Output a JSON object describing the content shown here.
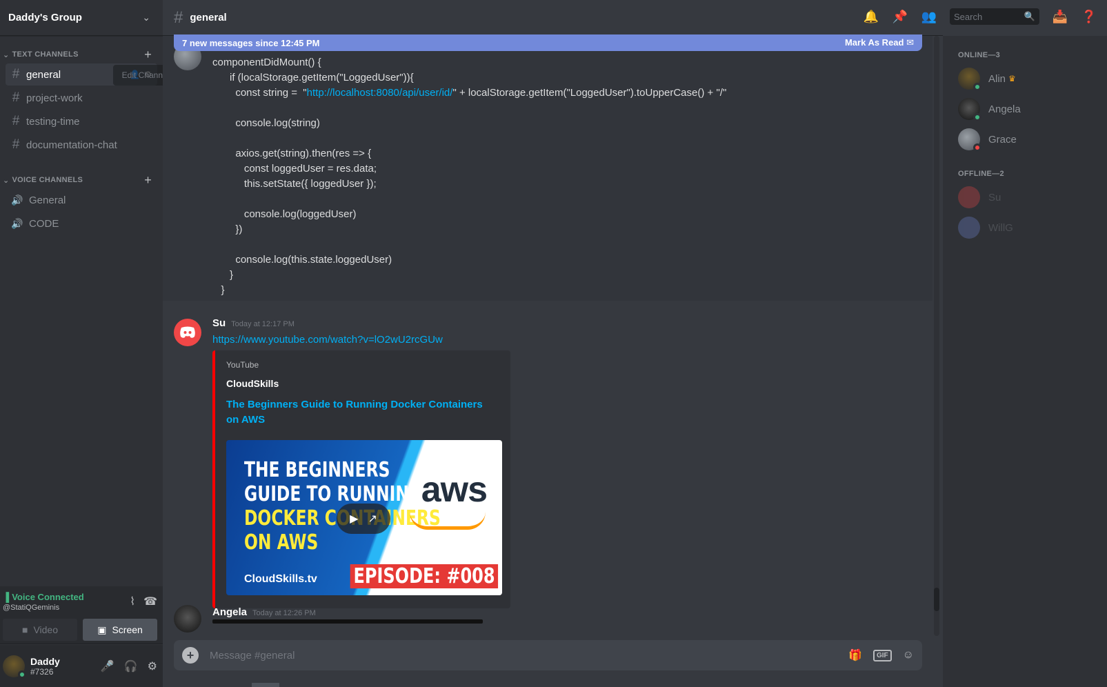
{
  "guild": {
    "name": "Daddy's Group"
  },
  "text_channels": {
    "label": "TEXT CHANNELS",
    "items": [
      "general",
      "project-work",
      "testing-time",
      "documentation-chat"
    ],
    "tooltip": "Edit Channel"
  },
  "voice_channels": {
    "label": "VOICE CHANNELS",
    "items": [
      "General",
      "CODE"
    ]
  },
  "voice_panel": {
    "status": "Voice Connected",
    "sub": "@StatiQGeminis",
    "video_label": "Video",
    "screen_label": "Screen"
  },
  "user": {
    "name": "Daddy",
    "tag": "#7326"
  },
  "header": {
    "channel": "general",
    "search_placeholder": "Search"
  },
  "new_messages": {
    "text": "7 new messages since 12:45 PM",
    "action": "Mark As Read"
  },
  "code_message": {
    "lines": [
      "componentDidMount() {",
      "      if (localStorage.getItem(\"LoggedUser\")){",
      "        const string =  \"",
      "",
      "        console.log(string)",
      "",
      "        axios.get(string).then(res => {",
      "           const loggedUser = res.data;",
      "           this.setState({ loggedUser });",
      "",
      "           console.log(loggedUser)",
      "        })",
      "",
      "        console.log(this.state.loggedUser)",
      "      }",
      "   }"
    ],
    "url": "http://localhost:8080/api/user/id/",
    "url_suffix": "\" + localStorage.getItem(\"LoggedUser\").toUpperCase() + \"/\""
  },
  "su_message": {
    "author": "Su",
    "timestamp": "Today at 12:17 PM",
    "link": "https://www.youtube.com/watch?v=lO2wU2rcGUw",
    "embed": {
      "provider": "YouTube",
      "author": "CloudSkills",
      "title": "The Beginners Guide to Running Docker Containers on AWS",
      "thumb_line1": "THE BEGINNERS",
      "thumb_line2": "GUIDE TO RUNNING",
      "thumb_line3": "DOCKER CONTAINERS",
      "thumb_line4": "ON AWS",
      "thumb_brand": "aws",
      "thumb_site": "CloudSkills.tv",
      "thumb_episode": "EPISODE: #008"
    }
  },
  "angela_message": {
    "author": "Angela",
    "timestamp": "Today at 12:26 PM"
  },
  "composer": {
    "placeholder": "Message #general",
    "gif_label": "GIF"
  },
  "members": {
    "online_label": "ONLINE—3",
    "online": [
      "Alin",
      "Angela",
      "Grace"
    ],
    "offline_label": "OFFLINE—2",
    "offline": [
      "Su",
      "WillG"
    ]
  },
  "colors": {
    "accent": "#7289da",
    "online": "#43b581",
    "dnd": "#f04747",
    "link": "#00b0f4"
  }
}
